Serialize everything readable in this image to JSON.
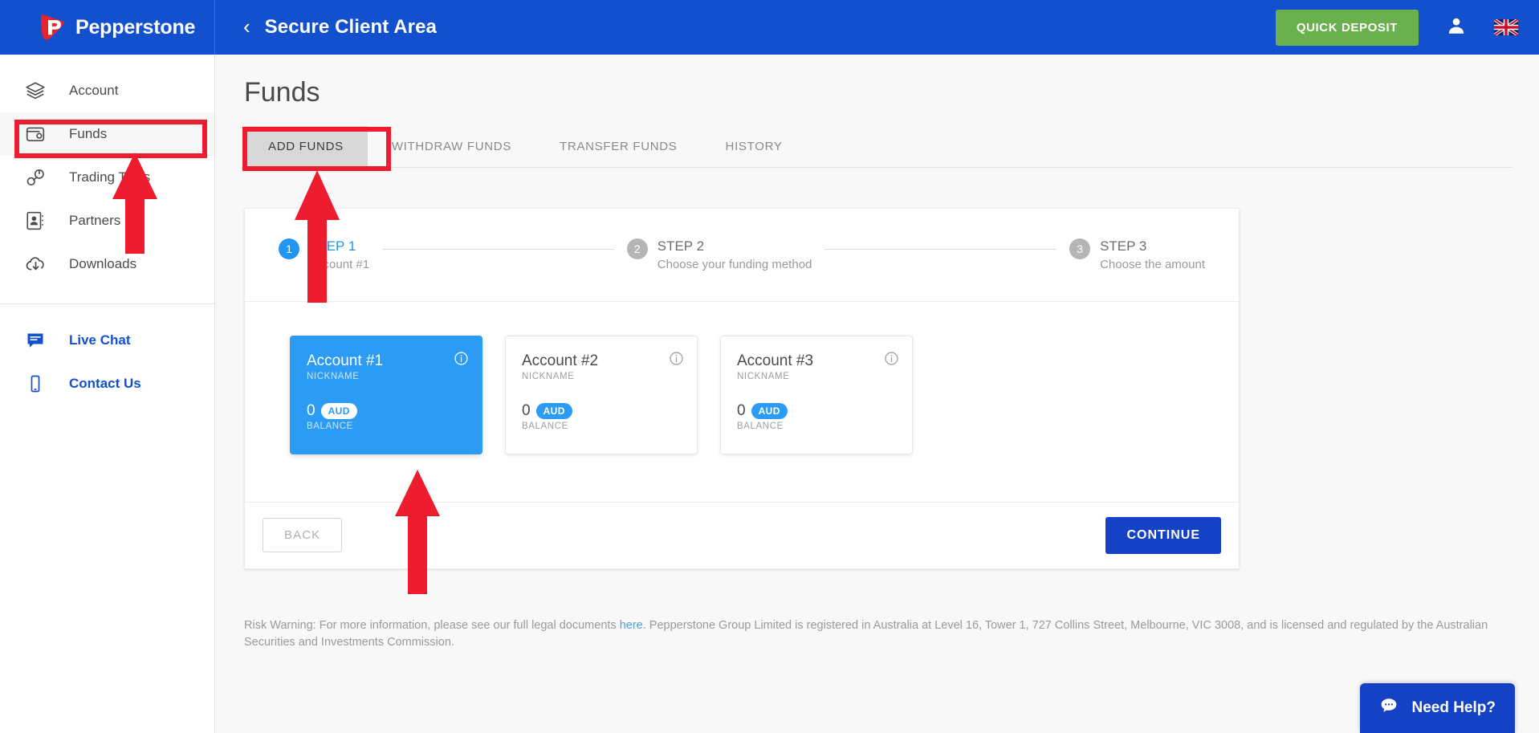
{
  "brand": {
    "name": "Pepperstone",
    "logo_icon": "pepperstone-logo"
  },
  "header": {
    "back_icon": "chevron-left-icon",
    "breadcrumb": "Secure Client Area",
    "quick_deposit_label": "QUICK DEPOSIT",
    "account_icon": "user-icon",
    "language_flag": "uk-flag-icon",
    "background_color": "#1250ce",
    "quick_deposit_color": "#6ab04c"
  },
  "sidebar": {
    "items": [
      {
        "label": "Account",
        "icon": "layers-icon",
        "active": false
      },
      {
        "label": "Funds",
        "icon": "wallet-icon",
        "active": true
      },
      {
        "label": "Trading Tools",
        "icon": "wrench-icon",
        "active": false
      },
      {
        "label": "Partners",
        "icon": "contact-book-icon",
        "active": false
      },
      {
        "label": "Downloads",
        "icon": "cloud-download-icon",
        "active": false
      }
    ],
    "links": [
      {
        "label": "Live Chat",
        "icon": "chat-icon"
      },
      {
        "label": "Contact Us",
        "icon": "mobile-icon"
      }
    ],
    "link_color": "#1250ce"
  },
  "main": {
    "page_title": "Funds",
    "tabs": [
      {
        "label": "ADD FUNDS",
        "active": true
      },
      {
        "label": "WITHDRAW FUNDS",
        "active": false
      },
      {
        "label": "TRANSFER FUNDS",
        "active": false
      },
      {
        "label": "HISTORY",
        "active": false
      }
    ],
    "steps": [
      {
        "number": "1",
        "name": "STEP 1",
        "sub": "Account #1",
        "active": true
      },
      {
        "number": "2",
        "name": "STEP 2",
        "sub": "Choose your funding method",
        "active": false
      },
      {
        "number": "3",
        "name": "STEP 3",
        "sub": "Choose the amount",
        "active": false
      }
    ],
    "accounts": [
      {
        "name": "Account #1",
        "sub_label": "NICKNAME",
        "balance": "0",
        "currency": "AUD",
        "balance_label": "BALANCE",
        "info_icon": "info-icon",
        "selected": true
      },
      {
        "name": "Account #2",
        "sub_label": "NICKNAME",
        "balance": "0",
        "currency": "AUD",
        "balance_label": "BALANCE",
        "info_icon": "info-icon",
        "selected": false
      },
      {
        "name": "Account #3",
        "sub_label": "NICKNAME",
        "balance": "0",
        "currency": "AUD",
        "balance_label": "BALANCE",
        "info_icon": "info-icon",
        "selected": false
      }
    ],
    "back_label": "BACK",
    "continue_label": "CONTINUE",
    "selected_color": "#2b9bf4",
    "continue_color": "#1542c4"
  },
  "risk_warning": {
    "lead": "Risk Warning: For more information, please see our full legal documents ",
    "link": "here",
    "rest": ". Pepperstone Group Limited is registered in Australia at Level 16, Tower 1, 727 Collins Street, Melbourne, VIC 3008, and is licensed and regulated by the Australian Securities and Investments Commission."
  },
  "need_help": {
    "label": "Need Help?",
    "icon": "chat-bubble-icon",
    "color": "#1542c4"
  },
  "annotations": {
    "color": "#ed1c2e",
    "boxes": 2,
    "arrows": 3
  }
}
